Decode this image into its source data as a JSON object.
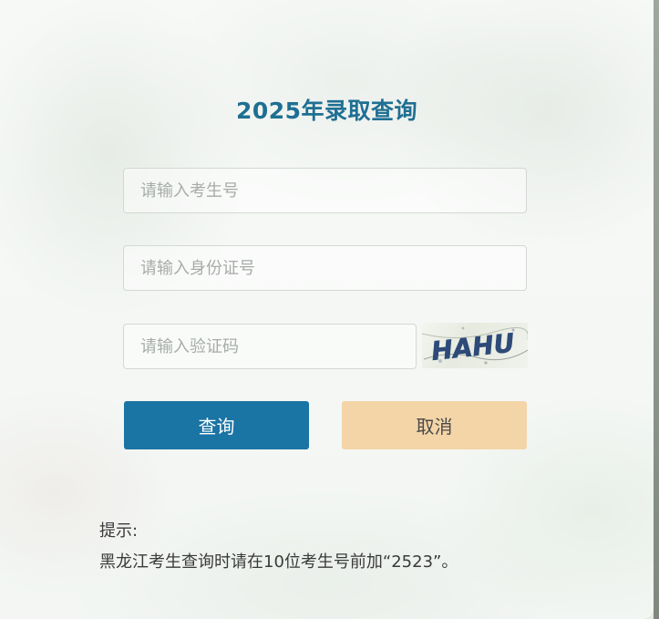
{
  "page": {
    "title": "2025年录取查询"
  },
  "form": {
    "exam_number": {
      "value": "",
      "placeholder": "请输入考生号"
    },
    "id_number": {
      "value": "",
      "placeholder": "请输入身份证号"
    },
    "captcha": {
      "value": "",
      "placeholder": "请输入验证码",
      "image_text": "HAHU"
    }
  },
  "buttons": {
    "query_label": "查询",
    "cancel_label": "取消"
  },
  "tip": {
    "label": "提示:",
    "text": "黑龙江考生查询时请在10位考生号前加“2523”。"
  },
  "colors": {
    "title": "#1f6f93",
    "query_button": "#1a74a4",
    "cancel_button": "#f4d5a8"
  }
}
